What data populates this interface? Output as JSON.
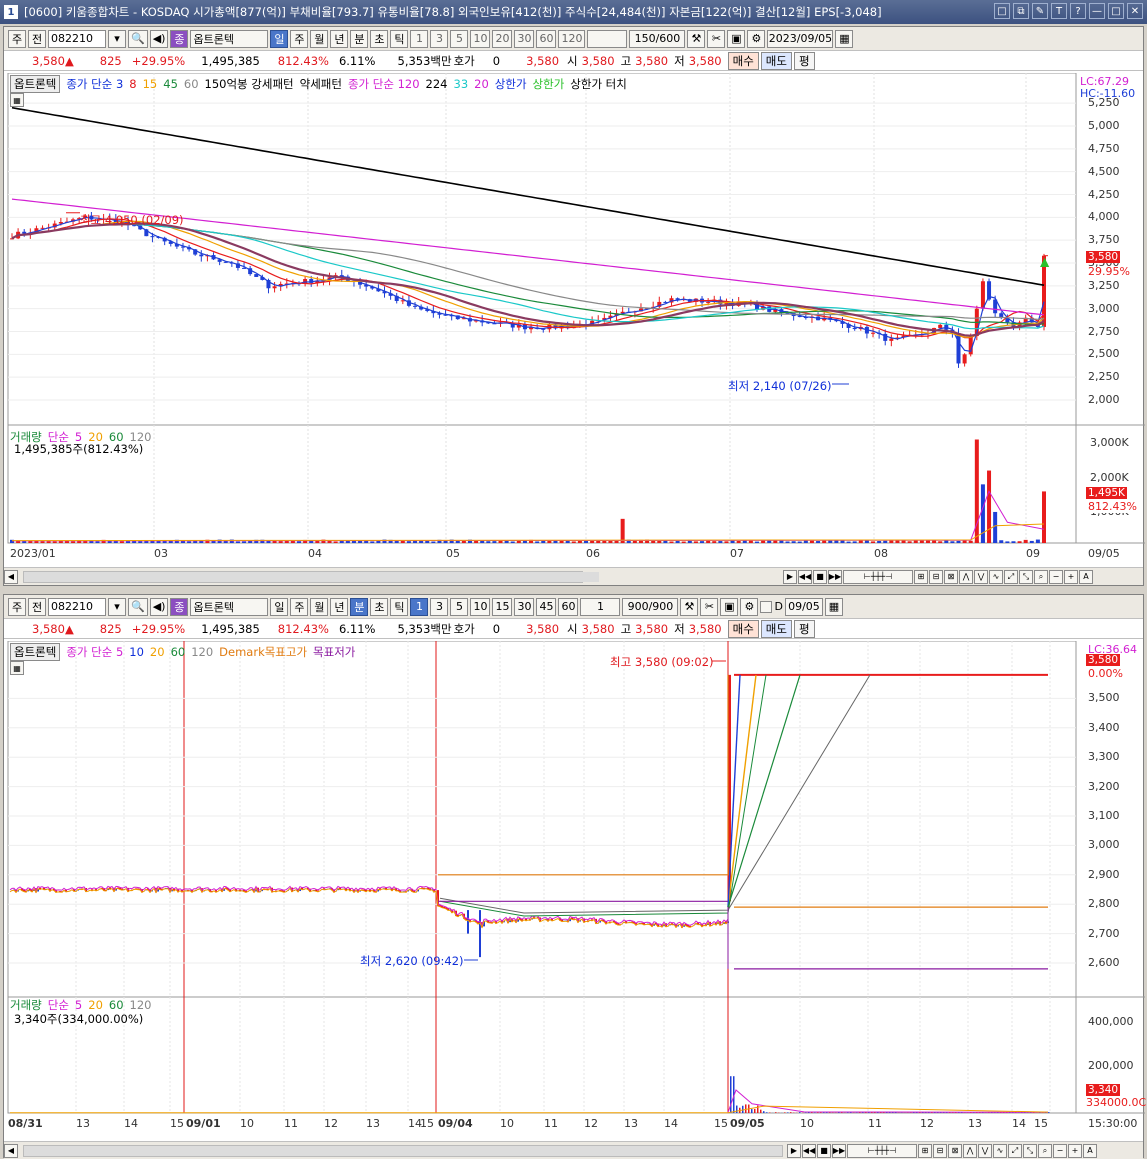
{
  "window": {
    "num": "1",
    "title": "[0600] 키움종합차트 - KOSDAQ 시가총액[877(억)] 부채비율[793.7] 유통비율[78.8] 외국인보유[412(천)] 주식수[24,484(천)] 자본금[122(억)] 결산[12월] EPS[-3,048]",
    "buttons": [
      "□",
      "⧉",
      "✎",
      "T",
      "?",
      "—",
      "□",
      "✕"
    ]
  },
  "top": {
    "toolbar": {
      "mode1": "주",
      "mode2": "전",
      "code": "082210",
      "badge": "종",
      "name": "옵트론텍",
      "periods": [
        "일",
        "주",
        "월",
        "년",
        "분",
        "초",
        "틱"
      ],
      "active_period": "일",
      "intervals": [
        "1",
        "3",
        "5",
        "10",
        "20",
        "30",
        "60",
        "120"
      ],
      "count": "150/600",
      "date": "2023/09/05"
    },
    "quote": {
      "price": "3,580",
      "change": "825",
      "pct": "+29.95%",
      "volume": "1,495,385",
      "vol_pct": "812.43%",
      "turnover": "6.11%",
      "amount": "5,353백만",
      "hoga_label": "호가",
      "hoga": "0",
      "hoga_price": "3,580",
      "open_label": "시",
      "open": "3,580",
      "high_label": "고",
      "high": "3,580",
      "low_label": "저",
      "low": "3,580",
      "buy": "매수",
      "sell": "매도",
      "eval": "평"
    },
    "legend": {
      "name": "옵트론텍",
      "ma_label": "종가 단순 3",
      "ma2": "8",
      "ma3": "15",
      "ma4": "45",
      "ma5": "60",
      "pattern": "150억봉 강세패턴",
      "weak": "약세패턴",
      "ma120": "종가 단순 120",
      "n1": "224",
      "n2": "33",
      "n3": "20",
      "limit_up": "상한가",
      "limit_up2": "상한가",
      "touch": "상한가 터치"
    },
    "axis_right": [
      "5,250",
      "5,000",
      "4,750",
      "4,500",
      "4,250",
      "4,000",
      "3,750",
      "3,500",
      "3,250",
      "3,000",
      "2,750",
      "2,500",
      "2,250",
      "2,000"
    ],
    "lc_hc": [
      "LC:67.29",
      "HC:-11.60"
    ],
    "last_price_box": "3,580",
    "last_pct": "29.95%",
    "high_ann": "최고 4,050 (02/09)",
    "low_ann": "최저 2,140 (07/26)",
    "vol_legend": {
      "label": "거래량",
      "type": "단순",
      "n1": "5",
      "n2": "20",
      "n3": "60",
      "n4": "120",
      "value": "1,495,385주(812.43%)"
    },
    "vol_axis": [
      "3,000K",
      "2,000K",
      "1,000K"
    ],
    "vol_box": "1,495K",
    "vol_box_pct": "812.43%",
    "x_labels": [
      "2023/01",
      "03",
      "04",
      "05",
      "06",
      "07",
      "08",
      "09",
      "09/05"
    ]
  },
  "bottom": {
    "toolbar": {
      "mode1": "주",
      "mode2": "전",
      "code": "082210",
      "badge": "종",
      "name": "옵트론텍",
      "periods": [
        "일",
        "주",
        "월",
        "년",
        "분",
        "초",
        "틱"
      ],
      "active_period": "분",
      "intervals": [
        "1",
        "3",
        "5",
        "10",
        "15",
        "30",
        "45",
        "60"
      ],
      "interval_sel": "1",
      "count": "900/900",
      "dlabel": "D",
      "date": "09/05"
    },
    "quote": {
      "price": "3,580",
      "change": "825",
      "pct": "+29.95%",
      "volume": "1,495,385",
      "vol_pct": "812.43%",
      "turnover": "6.11%",
      "amount": "5,353백만",
      "hoga_label": "호가",
      "hoga": "0",
      "hoga_price": "3,580",
      "open_label": "시",
      "open": "3,580",
      "high_label": "고",
      "high": "3,580",
      "low_label": "저",
      "low": "3,580",
      "buy": "매수",
      "sell": "매도",
      "eval": "평"
    },
    "legend": {
      "name": "옵트론텍",
      "ma_label": "종가 단순 5",
      "n1": "10",
      "n2": "20",
      "n3": "60",
      "n4": "120",
      "demark_hi": "Demark목표고가",
      "demark_lo": "목표저가"
    },
    "axis_right": [
      "3,500",
      "3,400",
      "3,300",
      "3,200",
      "3,100",
      "3,000",
      "2,900",
      "2,800",
      "2,700",
      "2,600"
    ],
    "lc_hc": "LC:36.64",
    "last_price_box": "3,580",
    "last_pct": "0.00%",
    "high_ann": "최고 3,580 (09:02)",
    "low_ann": "최저 2,620 (09:42)",
    "vol_legend": {
      "label": "거래량",
      "type": "단순",
      "n1": "5",
      "n2": "20",
      "n3": "60",
      "n4": "120",
      "value": "3,340주(334,000.00%)"
    },
    "vol_axis": [
      "400,000",
      "200,000"
    ],
    "vol_box": "3,340",
    "vol_box2": "334000.0C",
    "x_labels": [
      "08/31",
      "13",
      "14",
      "15",
      "09/01",
      "10",
      "11",
      "12",
      "13",
      "14",
      "15",
      "09/04",
      "10",
      "11",
      "12",
      "13",
      "14",
      "15",
      "09/05",
      "10",
      "11",
      "12",
      "13",
      "14",
      "15",
      "15:30:00"
    ]
  },
  "colors": {
    "up": "#e81c1c",
    "down": "#1f3fd6",
    "ma_black": "#000000",
    "ma_magenta": "#d21fd2"
  }
}
